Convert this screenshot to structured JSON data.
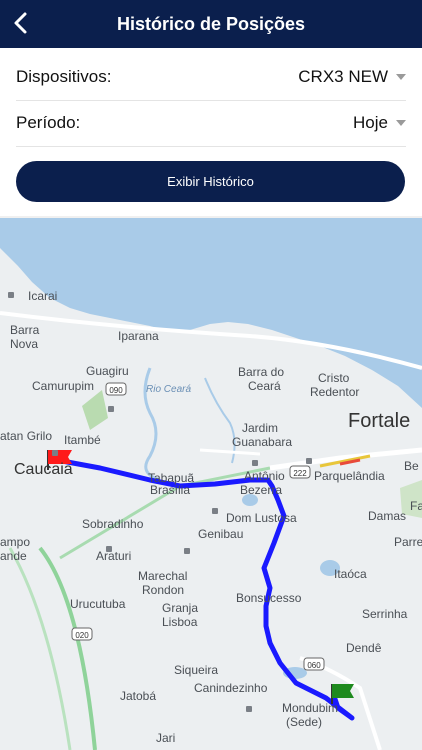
{
  "header": {
    "title": "Histórico de Posições",
    "back_icon": "chevron-left-icon"
  },
  "form": {
    "device_label": "Dispositivos:",
    "device_value": "CRX3 NEW",
    "period_label": "Período:",
    "period_value": "Hoje"
  },
  "button": {
    "label": "Exibir Histórico"
  },
  "map": {
    "labels": {
      "icarai": "Icarai",
      "barra_nova": "Barra\nNova",
      "iparana": "Iparana",
      "guagiru": "Guagiru",
      "camurupim": "Camurupim",
      "rio_ceara": "Rio Ceará",
      "barra_do_ceara": "Barra do\nCeará",
      "cristo_redentor": "Cristo\nRedentor",
      "fortaleza": "Fortale",
      "jardim_guanabara": "Jardim\nGuanabara",
      "catan_grilo": "atan Grilo",
      "itambe": "Itambé",
      "caucaia": "Caucaia",
      "tabapua_brasilia": "Tabapuã\nBrasília",
      "antonio_bezerra": "Antônio\nBezerra",
      "parquelandia": "Parquelândia",
      "dom_lustosa": "Dom Lustosa",
      "damas": "Damas",
      "sobradinho": "Sobradinho",
      "genibau": "Genibau",
      "parre": "Parre",
      "campo_grande": "ampo\nande",
      "araturi": "Araturi",
      "marechal_rondon": "Marechal\nRondon",
      "itaoca": "Itaóca",
      "bonsucesso": "Bonsucesso",
      "urucutuba": "Urucutuba",
      "granja_lisboa": "Granja\nLisboa",
      "serrinha": "Serrinha",
      "dende": "Dendê",
      "siqueira": "Siqueira",
      "canindezinho": "Canindezinho",
      "jatoba": "Jatobá",
      "mondubim": "Mondubim\n(Sede)",
      "jari": "Jari",
      "be": "Be",
      "fa": "Fa",
      "road_222": "222",
      "road_090": "090",
      "road_020": "020",
      "road_060": "060"
    },
    "route_color": "#1a1aff",
    "start_flag_color": "#ff1a1a",
    "end_flag_color": "#1e8a1e",
    "water_color": "#a9cbe8"
  }
}
